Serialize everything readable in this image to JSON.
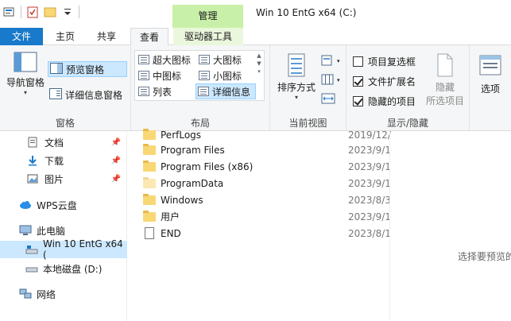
{
  "window": {
    "title": "Win 10 EntG x64 (C:)",
    "context_tab_group": "管理"
  },
  "tabs": {
    "file": "文件",
    "home": "主页",
    "share": "共享",
    "view": "查看",
    "drive_tools": "驱动器工具"
  },
  "ribbon": {
    "panes": {
      "group_label": "窗格",
      "nav_pane": "导航窗格",
      "preview_pane": "预览窗格",
      "details_pane": "详细信息窗格"
    },
    "layout": {
      "group_label": "布局",
      "items": [
        "超大图标",
        "大图标",
        "中图标",
        "小图标",
        "列表",
        "详细信息"
      ]
    },
    "current_view": {
      "group_label": "当前视图",
      "sort_by": "排序方式"
    },
    "show_hide": {
      "group_label": "显示/隐藏",
      "item_checkboxes": "项目复选框",
      "file_extensions": "文件扩展名",
      "hidden_items": "隐藏的项目",
      "hide_selected_line1": "隐藏",
      "hide_selected_line2": "所选项目",
      "states": {
        "item_checkboxes": false,
        "file_extensions": true,
        "hidden_items": true
      }
    },
    "options": {
      "label": "选项"
    }
  },
  "nav": {
    "items": [
      {
        "label": "文档",
        "pinned": true
      },
      {
        "label": "下载",
        "pinned": true
      },
      {
        "label": "图片",
        "pinned": true
      },
      {
        "label": "WPS云盘",
        "pinned": false
      },
      {
        "label": "此电脑",
        "pinned": false
      },
      {
        "label": "Win 10 EntG x64 (",
        "pinned": false
      },
      {
        "label": "本地磁盘 (D:)",
        "pinned": false
      },
      {
        "label": "网络",
        "pinned": false
      }
    ]
  },
  "files": [
    {
      "name": "PerfLogs",
      "date": "2019/12/",
      "type": "folder"
    },
    {
      "name": "Program Files",
      "date": "2023/9/1",
      "type": "folder"
    },
    {
      "name": "Program Files (x86)",
      "date": "2023/9/1",
      "type": "folder"
    },
    {
      "name": "ProgramData",
      "date": "2023/9/1",
      "type": "folder"
    },
    {
      "name": "Windows",
      "date": "2023/8/3",
      "type": "folder"
    },
    {
      "name": "用户",
      "date": "2023/9/1",
      "type": "folder"
    },
    {
      "name": "END",
      "date": "2023/8/1",
      "type": "file"
    }
  ],
  "preview": {
    "message": "选择要预览的"
  }
}
